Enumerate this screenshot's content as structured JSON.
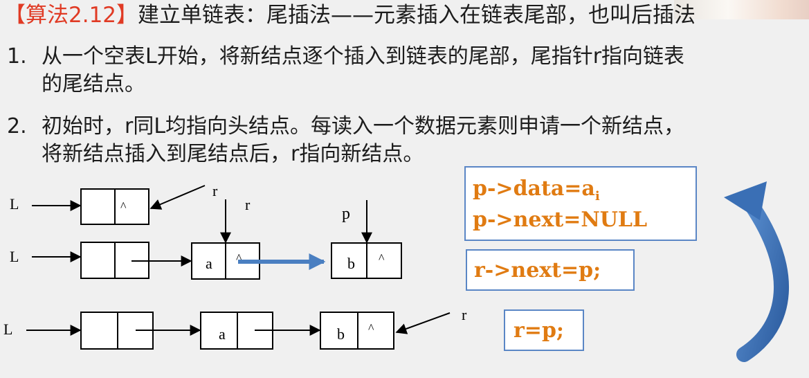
{
  "title": {
    "tag": "【算法2.12】",
    "text": "建立单链表：尾插法——元素插入在链表尾部，也叫后插法"
  },
  "items": [
    {
      "num": "1.",
      "lines": [
        "从一个空表L开始，将新结点逐个插入到链表的尾部，尾指针r指向链表",
        "的尾结点。"
      ]
    },
    {
      "num": "2.",
      "lines": [
        "初始时，r同L均指向头结点。每读入一个数据元素则申请一个新结点，",
        "将新结点插入到尾结点后，r指向新结点。"
      ]
    }
  ],
  "diagram": {
    "L": "L",
    "r": "r",
    "p": "p",
    "a": "a",
    "b": "b",
    "null_mark": "^"
  },
  "code": {
    "box1": {
      "line1": "p->data=a",
      "line1_sub": "i",
      "line2": "p->next=NULL"
    },
    "box2": "r->next=p;",
    "box3": "r=p;"
  },
  "colors": {
    "accent_red": "#e03a24",
    "code_orange": "#e07b12",
    "box_border": "#5a86c5",
    "arrow_blue": "#4a7fc1"
  }
}
